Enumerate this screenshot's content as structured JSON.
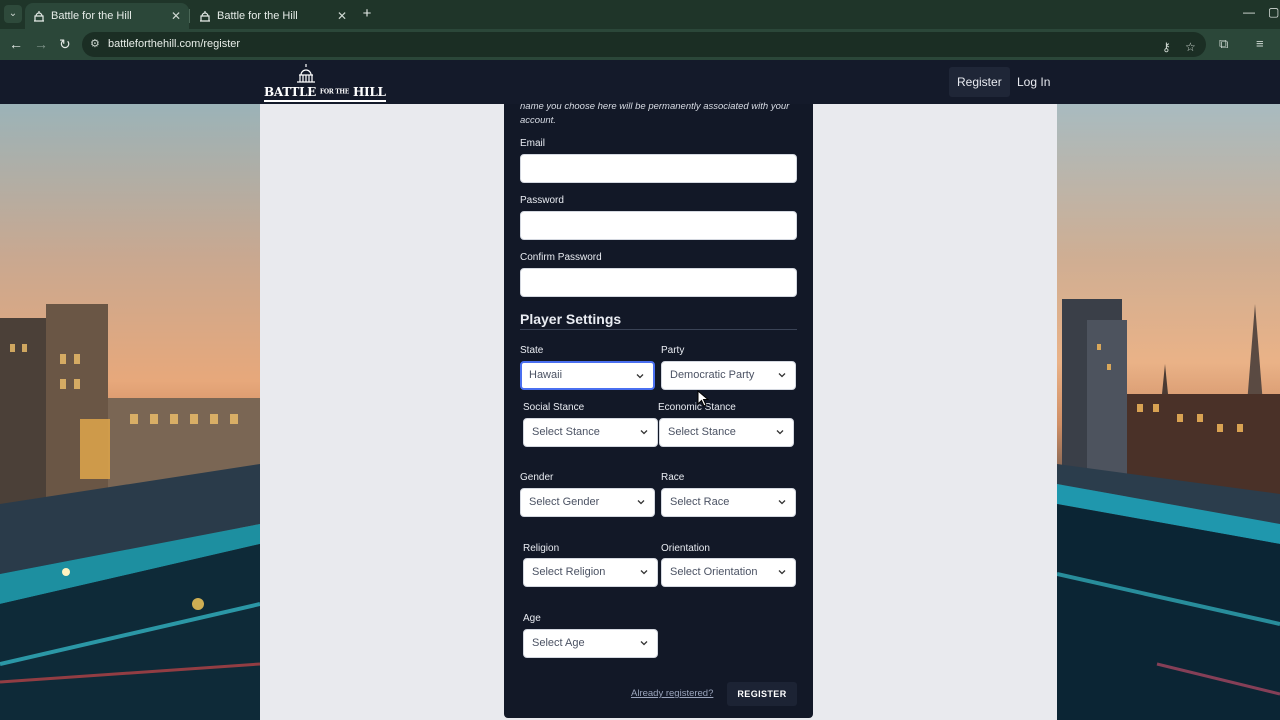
{
  "browser": {
    "tabs": [
      {
        "title": "Battle for the Hill",
        "active": true
      },
      {
        "title": "Battle for the Hill",
        "active": false
      }
    ],
    "url": "battleforthehill.com/register"
  },
  "site": {
    "logo_text": "BATTLE",
    "logo_small": "FOR THE",
    "logo_text2": "HILL",
    "nav": [
      {
        "label": "Register",
        "active": true
      },
      {
        "label": "Log In",
        "active": false
      }
    ]
  },
  "form": {
    "help_text": "name you choose here will be permanently associated with your account.",
    "email_label": "Email",
    "password_label": "Password",
    "confirm_password_label": "Confirm Password",
    "player_settings_title": "Player Settings",
    "selects": {
      "state": {
        "label": "State",
        "value": "Hawaii"
      },
      "party": {
        "label": "Party",
        "value": "Democratic Party"
      },
      "social_stance": {
        "label": "Social Stance",
        "value": "Select Stance"
      },
      "economic_stance": {
        "label": "Economic Stance",
        "value": "Select Stance"
      },
      "gender": {
        "label": "Gender",
        "value": "Select Gender"
      },
      "race": {
        "label": "Race",
        "value": "Select Race"
      },
      "religion": {
        "label": "Religion",
        "value": "Select Religion"
      },
      "orientation": {
        "label": "Orientation",
        "value": "Select Orientation"
      },
      "age": {
        "label": "Age",
        "value": "Select Age"
      }
    },
    "already_registered": "Already registered?",
    "register_button": "REGISTER"
  },
  "colors": {
    "header_bg": "#141a2a",
    "card_bg": "#121827",
    "page_bg": "#e9eaee",
    "focus_ring": "#4a6ff0"
  }
}
